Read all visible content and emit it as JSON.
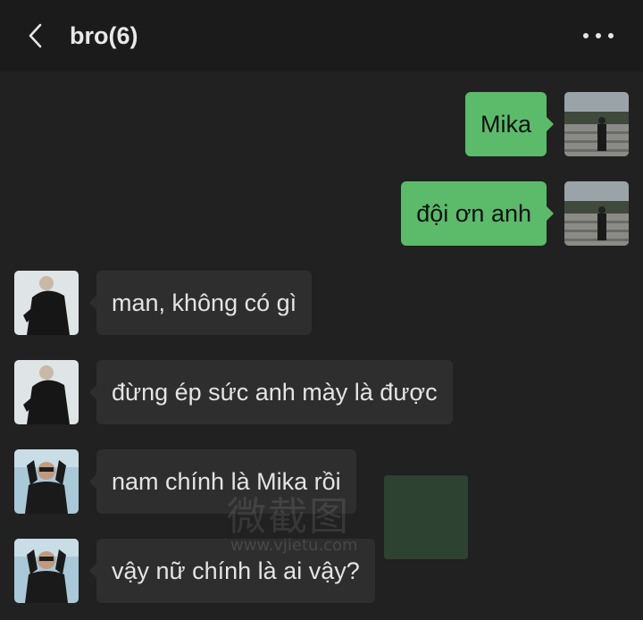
{
  "header": {
    "title": "bro(6)",
    "back_icon": "chevron-left-icon",
    "more_icon": "more-horizontal-icon"
  },
  "messages": [
    {
      "side": "out",
      "text": "Mika",
      "avatar": "self-avatar"
    },
    {
      "side": "out",
      "text": "đội ơn anh",
      "avatar": "self-avatar"
    },
    {
      "side": "in",
      "text": "man, không có gì",
      "avatar": "member-avatar-1"
    },
    {
      "side": "in",
      "text": "đừng ép sức anh mày là được",
      "avatar": "member-avatar-1"
    },
    {
      "side": "in",
      "text": "nam chính là Mika rồi",
      "avatar": "member-avatar-2"
    },
    {
      "side": "in",
      "text": "vậy nữ chính là ai vậy?",
      "avatar": "member-avatar-2"
    }
  ],
  "watermark": {
    "text": "微截图",
    "url": "www.vjietu.com"
  },
  "colors": {
    "background": "#212121",
    "header": "#1b1b1b",
    "outgoing_bubble": "#5bbb6b",
    "incoming_bubble": "#2e2e2e"
  }
}
